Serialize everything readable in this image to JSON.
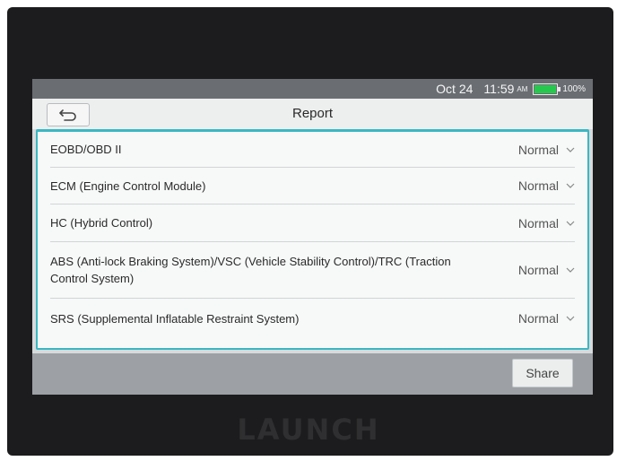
{
  "status_bar": {
    "date": "Oct 24",
    "time": "11:59",
    "ampm": "AM",
    "battery_level": 100,
    "battery_text": "100%",
    "battery_color": "#26c94d"
  },
  "header": {
    "title": "Report",
    "back_icon": "return-arrow-icon"
  },
  "report": {
    "rows": [
      {
        "label": "EOBD/OBD II",
        "status": "Normal"
      },
      {
        "label": "ECM (Engine Control Module)",
        "status": "Normal"
      },
      {
        "label": "HC (Hybrid Control)",
        "status": "Normal"
      },
      {
        "label": "ABS (Anti-lock Braking System)/VSC (Vehicle Stability Control)/TRC (Traction Control System)",
        "status": "Normal"
      },
      {
        "label": "SRS (Supplemental Inflatable Restraint System)",
        "status": "Normal"
      }
    ]
  },
  "footer": {
    "share_label": "Share"
  },
  "device": {
    "brand": "LAUNCH"
  },
  "colors": {
    "accent": "#3bb7c2",
    "status_bar_bg": "#6a6e73",
    "bottom_bar_bg": "#9da1a5"
  }
}
